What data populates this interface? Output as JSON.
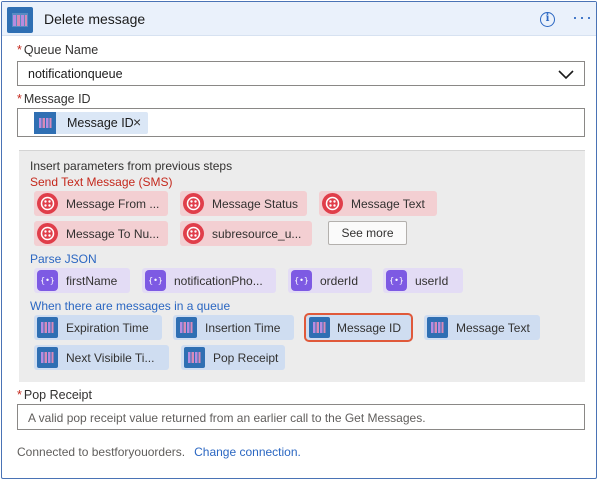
{
  "header": {
    "title": "Delete message"
  },
  "queue_name": {
    "label": "Queue Name",
    "required_mark": "*",
    "value": "notificationqueue"
  },
  "message_id": {
    "label": "Message ID",
    "required_mark": "*",
    "token_label": "Message ID",
    "token_remove": "×"
  },
  "dynamic": {
    "intro": "Insert parameters from previous steps",
    "sms": {
      "title": "Send Text Message (SMS)",
      "title_color": "#c4281c",
      "items": [
        "Message From ...",
        "Message Status",
        "Message Text",
        "Message To Nu...",
        "subresource_u..."
      ],
      "see_more": "See more"
    },
    "json": {
      "title": "Parse JSON",
      "title_color": "#2b67c2",
      "icon_glyph": "{•}",
      "items": [
        "firstName",
        "notificationPho...",
        "orderId",
        "userId"
      ]
    },
    "queue": {
      "title": "When there are messages in a queue",
      "title_color": "#2b67c2",
      "items": [
        "Expiration Time",
        "Insertion Time",
        "Message ID",
        "Message Text",
        "Next Visibile Ti...",
        "Pop Receipt"
      ],
      "selected": "Message ID"
    }
  },
  "pop_receipt": {
    "label": "Pop Receipt",
    "required_mark": "*",
    "placeholder": "A valid pop receipt value returned from an earlier call to the Get Messages."
  },
  "footer": {
    "connected_text": "Connected to bestforyouorders.",
    "change_link": "Change connection."
  },
  "colors": {
    "accent": "#2b67c2",
    "required": "#c4281c",
    "selection_outline": "#e0593a"
  }
}
